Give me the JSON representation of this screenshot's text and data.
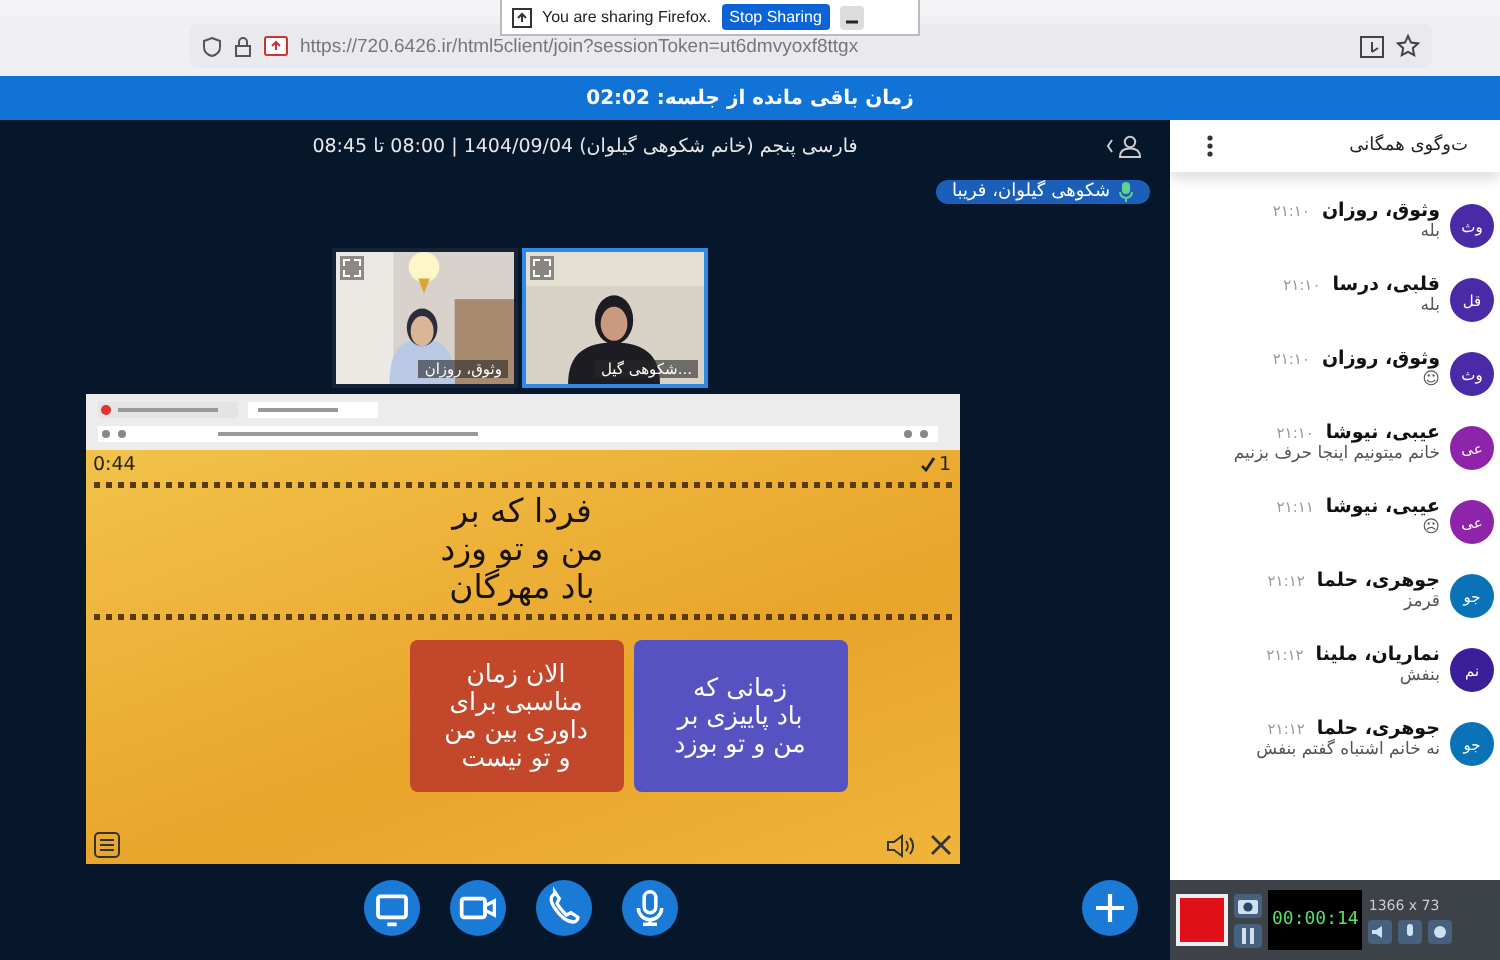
{
  "browser": {
    "url": "https://720.6426.ir/html5client/join?sessionToken=ut6dmvyoxf8ttgx",
    "sharing_notice": {
      "message": "You are sharing Firefox.",
      "button": "Stop Sharing"
    }
  },
  "banner": {
    "text": "زمان باقی مانده از جلسه: 02:02"
  },
  "meeting": {
    "title": "فارسی پنجم (خانم شکوهی گیلوان) 1404/09/04 | 08:00 تا 08:45",
    "talking": "شکوهی گیلوان، فریبا",
    "webcams": [
      {
        "name": "شکوهی گیل...",
        "talking": true
      },
      {
        "name": "وثوق، روزان",
        "talking": false
      }
    ]
  },
  "presentation": {
    "timer": "0:44",
    "score": "1",
    "prompt": "فردا که بر\nمن و تو وزد\nباد مهرگان",
    "options": [
      {
        "text": "زمانی که\nباد پاییزی بر\nمن و تو بوزد",
        "color": "#5752c2"
      },
      {
        "text": "الان زمان\nمناسبی برای\nداوری بین من\nو تو نیست",
        "color": "#c3472b"
      }
    ]
  },
  "actions": [
    {
      "kind": "screen"
    },
    {
      "kind": "camera"
    },
    {
      "kind": "phone"
    },
    {
      "kind": "mic"
    },
    {
      "kind": "plus"
    }
  ],
  "chat": {
    "title": "ت‌وگوی همگانی",
    "messages": [
      {
        "initials": "وث",
        "name": "وثوق، روزان",
        "time": "۲۱:۱۰",
        "text": "بله",
        "color": "#4b2aa8"
      },
      {
        "initials": "قل",
        "name": "قلبی، درسا",
        "time": "۲۱:۱۰",
        "text": "بله",
        "color": "#4b2aa8"
      },
      {
        "initials": "وث",
        "name": "وثوق، روزان",
        "time": "۲۱:۱۰",
        "text": "☺",
        "color": "#4b2aa8"
      },
      {
        "initials": "عی",
        "name": "عیبی، نیوشا",
        "time": "۲۱:۱۰",
        "text": "خانم میتونیم اینجا حرف بزنیم",
        "color": "#8e24aa"
      },
      {
        "initials": "عی",
        "name": "عیبی، نیوشا",
        "time": "۲۱:۱۱",
        "text": "☹",
        "color": "#8e24aa"
      },
      {
        "initials": "جو",
        "name": "جوهری، حلما",
        "time": "۲۱:۱۲",
        "text": "قرمز",
        "color": "#0a73b8"
      },
      {
        "initials": "نم",
        "name": "نماریان، ملینا",
        "time": "۲۱:۱۲",
        "text": "بنفش",
        "color": "#3b1f9a"
      },
      {
        "initials": "جو",
        "name": "جوهری، حلما",
        "time": "۲۱:۱۲",
        "text": "نه خانم اشتباه گفتم بنفش",
        "color": "#0a73b8"
      }
    ]
  },
  "recorder": {
    "counter": "00:00:14",
    "resolution": "1366 x 73"
  }
}
